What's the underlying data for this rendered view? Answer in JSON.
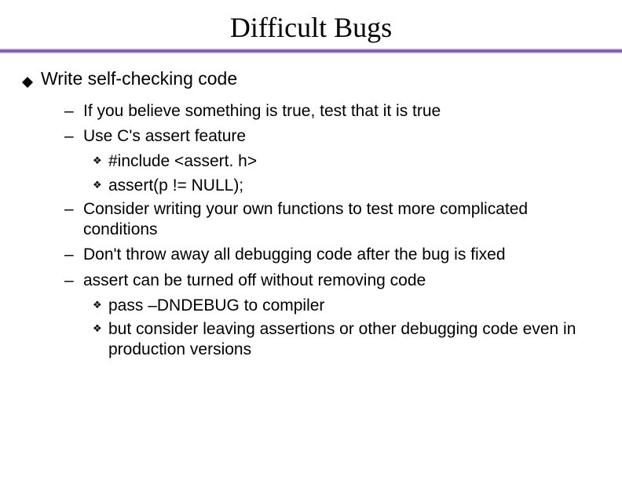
{
  "title": "Difficult Bugs",
  "main_bullet": "Write self-checking code",
  "items": [
    {
      "text": "If you believe something is true, test that it is true"
    },
    {
      "text": "Use C's assert feature",
      "sub": [
        "#include <assert. h>",
        "assert(p != NULL);"
      ]
    },
    {
      "text": "Consider writing your own functions to test more complicated conditions"
    },
    {
      "text": "Don't throw away all debugging code after the bug is fixed"
    },
    {
      "text": "assert can be turned off without removing code",
      "sub": [
        "pass –DNDEBUG to compiler",
        "but consider leaving assertions or other debugging code even in production versions"
      ]
    }
  ]
}
